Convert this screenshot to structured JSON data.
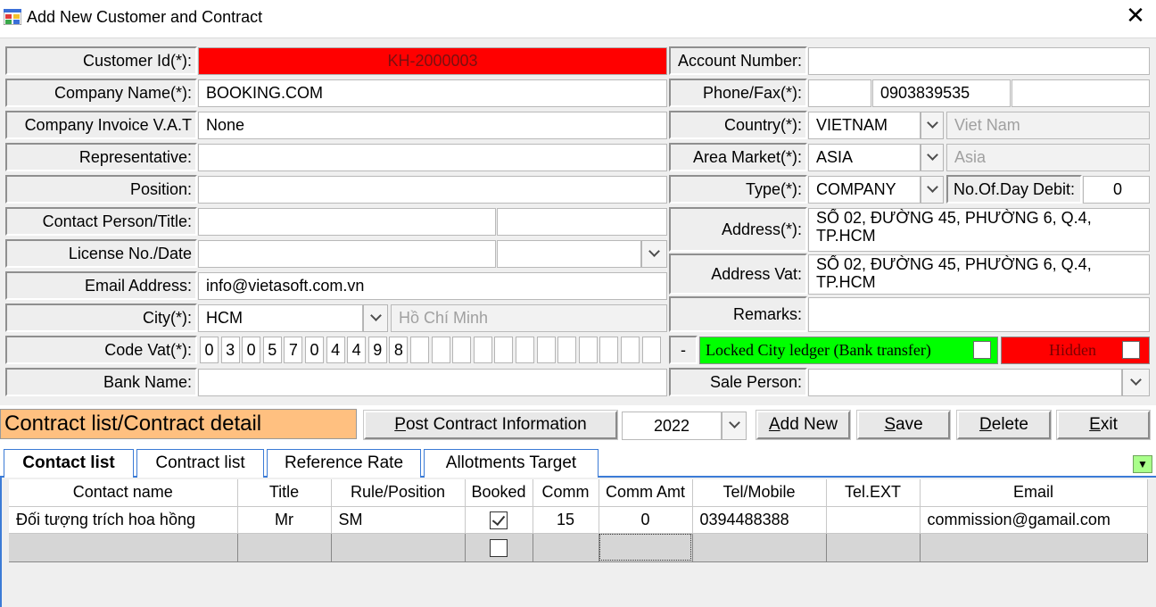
{
  "window": {
    "title": "Add New Customer and Contract",
    "close_icon": "close-icon"
  },
  "form": {
    "customer_id_label": "Customer Id(*):",
    "customer_id_value": "KH-2000003",
    "company_name_label": "Company Name(*):",
    "company_name_value": "BOOKING.COM",
    "invoice_vat_label": "Company Invoice V.A.T",
    "invoice_vat_value": "None",
    "representative_label": "Representative:",
    "representative_value": "",
    "position_label": "Position:",
    "position_value": "",
    "contact_person_label": "Contact Person/Title:",
    "contact_person_value": "",
    "contact_title_value": "",
    "license_label": "License No./Date",
    "license_value": "",
    "license_date_value": "",
    "email_label": "Email Address:",
    "email_value": "info@vietasoft.com.vn",
    "city_label": "City(*):",
    "city_value": "HCM",
    "city_name": "Hồ Chí Minh",
    "code_vat_label": "Code Vat(*):",
    "code_vat_digits": [
      "0",
      "3",
      "0",
      "5",
      "7",
      "0",
      "4",
      "4",
      "9",
      "8",
      "",
      "",
      "",
      "",
      "",
      "",
      "",
      "",
      "",
      "",
      "",
      ""
    ],
    "bank_name_label": "Bank Name:",
    "bank_name_value": "",
    "account_number_label": "Account Number:",
    "account_number_value": "",
    "phone_label": "Phone/Fax(*):",
    "phone_prefix": "",
    "phone_value": "0903839535",
    "fax_value": "",
    "country_label": "Country(*):",
    "country_value": "VIETNAM",
    "country_name": "Viet Nam",
    "area_label": "Area Market(*):",
    "area_value": "ASIA",
    "area_name": "Asia",
    "type_label": "Type(*):",
    "type_value": "COMPANY",
    "debit_label": "No.Of.Day Debit:",
    "debit_value": "0",
    "address_label": "Address(*):",
    "address_value": "SỐ 02, ĐƯỜNG 45, PHƯỜNG 6, Q.4, TP.HCM",
    "address_vat_label": "Address Vat:",
    "address_vat_value": "SỐ 02, ĐƯỜNG 45, PHƯỜNG 6, Q.4, TP.HCM",
    "remarks_label": "Remarks:",
    "remarks_value": "",
    "dash_label": "-",
    "locked_label": "Locked City ledger (Bank transfer)",
    "locked_checked": false,
    "hidden_label": "Hidden",
    "hidden_checked": false,
    "sale_person_label": "Sale Person:",
    "sale_person_value": ""
  },
  "toolbar": {
    "section_title": "Contract list/Contract detail",
    "post_contract_pre": "",
    "post_contract_key": "P",
    "post_contract_rest": "ost Contract Information",
    "year_value": "2022",
    "add_key": "A",
    "add_rest": "dd New",
    "save_key": "S",
    "save_rest": "ave",
    "delete_key": "D",
    "delete_rest": "elete",
    "exit_key": "E",
    "exit_rest": "xit"
  },
  "tabs": [
    "Contact list",
    "Contract list",
    "Reference Rate",
    "Allotments Target"
  ],
  "grid": {
    "columns": [
      "Contact name",
      "Title",
      "Rule/Position",
      "Booked",
      "Comm",
      "Comm Amt",
      "Tel/Mobile",
      "Tel.EXT",
      "Email"
    ],
    "rows": [
      {
        "contact_name": "Đối tượng trích hoa hồng",
        "title": "Mr",
        "rule": "SM",
        "booked": true,
        "comm": "15",
        "comm_amt": "0",
        "tel": "0394488388",
        "tel_ext": "",
        "email": "commission@gamail.com"
      }
    ]
  }
}
